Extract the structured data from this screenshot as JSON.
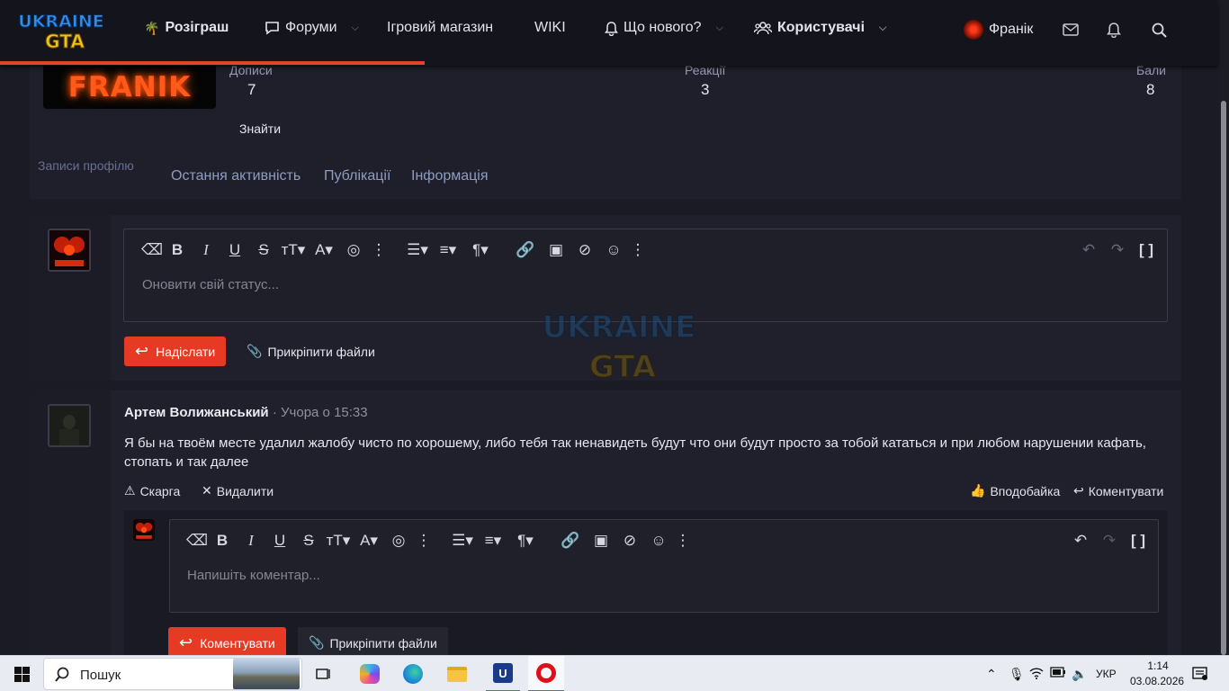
{
  "nav": {
    "logo_line1": "UKRAINE",
    "logo_line2": "GTA",
    "items": [
      {
        "label": "Розіграш"
      },
      {
        "label": "Форуми"
      },
      {
        "label": "Ігровий магазин"
      },
      {
        "label": "WIKI"
      },
      {
        "label": "Що нового?"
      },
      {
        "label": "Користувачі"
      }
    ],
    "user": "Франік",
    "accent": "#e0452a"
  },
  "profile": {
    "banner_text": "FRANIK",
    "stats": [
      {
        "label": "Дописи",
        "value": "7"
      },
      {
        "label": "Реакції",
        "value": "3"
      },
      {
        "label": "Бали",
        "value": "8"
      }
    ],
    "find_label": "Знайти",
    "tabs": [
      "Записи профілю",
      "Остання активність",
      "Публікації",
      "Інформація"
    ]
  },
  "status_editor": {
    "placeholder": "Оновити свій статус...",
    "submit_label": "Надіслати",
    "attach_label": "Прикріпити файли"
  },
  "post": {
    "author": "Артем Волижанський",
    "date": "Учора о 15:33",
    "separator": "·",
    "text": "Я бы на твоём месте удалил жалобу чисто по хорошему, либо тебя так ненавидеть будут что они будут просто за тобой кататься и при любом нарушении кафать, стопать и так далее",
    "report_label": "Скарга",
    "delete_label": "Видалити",
    "like_label": "Вподобайка",
    "comment_action_label": "Коментувати"
  },
  "comment_editor": {
    "placeholder": "Напишіть коментар...",
    "submit_label": "Коментувати",
    "attach_label": "Прикріпити файли"
  },
  "taskbar": {
    "search_label": "Пошук",
    "lang": "УКР",
    "time": "1:14",
    "date": "03.08.2026"
  }
}
